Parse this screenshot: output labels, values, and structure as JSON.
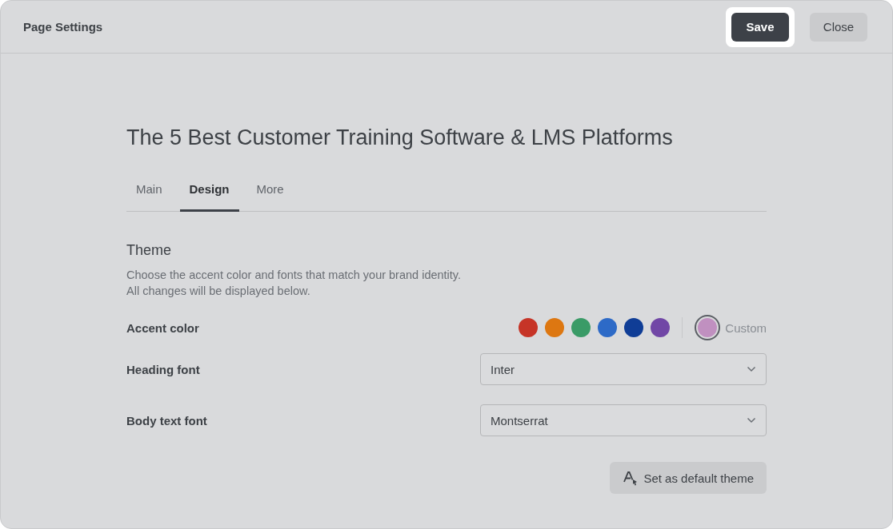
{
  "header": {
    "title": "Page Settings",
    "buttons": [
      {
        "label": "Save",
        "kind": "primary",
        "focused": true
      },
      {
        "label": "Close",
        "kind": "secondary",
        "focused": false
      }
    ]
  },
  "page_title": "The 5 Best Customer Training Software & LMS Platforms",
  "tabs": [
    {
      "label": "Main",
      "selected": false
    },
    {
      "label": "Design",
      "selected": true
    },
    {
      "label": "More",
      "selected": false
    }
  ],
  "theme": {
    "heading": "Theme",
    "description": [
      "Choose the accent color and fonts that match your brand identity.",
      "All changes will be displayed below."
    ],
    "accent": {
      "label": "Accent color",
      "swatches": [
        {
          "color": "#c63427",
          "selected": false
        },
        {
          "color": "#dd7711",
          "selected": false
        },
        {
          "color": "#3a9b67",
          "selected": false
        },
        {
          "color": "#2d6ac7",
          "selected": false
        },
        {
          "color": "#0f3d96",
          "selected": false
        },
        {
          "color": "#7147a6",
          "selected": false
        }
      ],
      "custom": {
        "label": "Custom",
        "color": "#c090c0",
        "selected": true
      }
    },
    "fonts": [
      {
        "label": "Heading font",
        "value": "Inter"
      },
      {
        "label": "Body text font",
        "value": "Montserrat"
      }
    ],
    "default_button": "Set as default theme"
  }
}
